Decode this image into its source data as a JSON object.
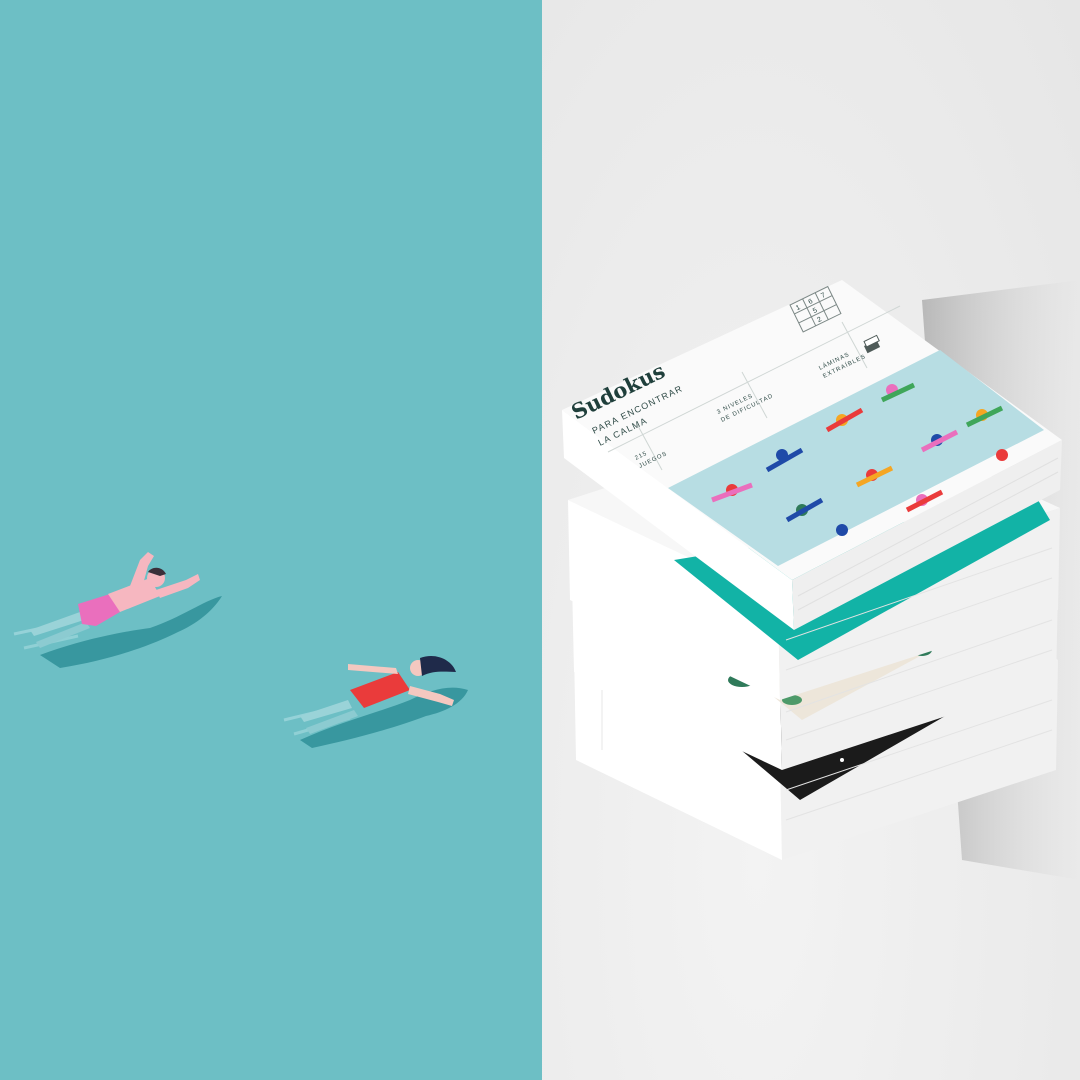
{
  "colors": {
    "water": "#6dbfc5",
    "backdrop": "#ececec",
    "cover_white": "#fafafa",
    "cover_pattern_bg": "#b7dde3",
    "teal_book": "#12b3a6",
    "dark_book": "#1b1b1b",
    "swimsuit_red": "#ea3b3b",
    "shorts_pink": "#ea6fbd"
  },
  "book_cover": {
    "title": "Sudokus",
    "subtitle_line1": "PARA ENCONTRAR",
    "subtitle_line2": "LA CALMA",
    "games_count": "215",
    "games_label": "JUEGOS",
    "levels_line1": "3 NIVELES",
    "levels_line2": "DE DIFICULTAD",
    "sheets_line1": "LÁMINAS",
    "sheets_line2": "EXTRAÍBLES",
    "grid_digits": [
      "1",
      "6",
      "7",
      "5",
      "2"
    ]
  },
  "scene": {
    "left_panel": "swimmers-illustration",
    "right_panel": "sudoku-book-stack-photo",
    "swimmers": [
      "man-pink-shorts",
      "woman-red-swimsuit"
    ],
    "stack_books": [
      "yoga-pattern-cover",
      "teal-cover",
      "leaf-pattern-cover",
      "night-sky-cover"
    ]
  }
}
